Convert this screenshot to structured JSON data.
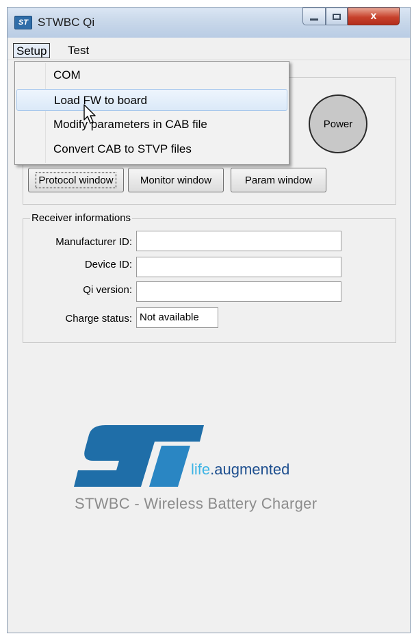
{
  "window": {
    "title": "STWBC Qi",
    "icon": "st-logo-icon",
    "close_glyph": "x"
  },
  "menubar": {
    "setup": "Setup",
    "test": "Test"
  },
  "setup_menu": {
    "items": [
      "COM",
      "Load FW to board",
      "Modify parameters in CAB file",
      "Convert CAB to STVP files"
    ],
    "highlighted": "Load FW to board"
  },
  "controls": {
    "power": "Power",
    "protocol_window": "Protocol window",
    "monitor_window": "Monitor window",
    "param_window": "Param window"
  },
  "receiver": {
    "title": "Receiver informations",
    "manufacturer_id_label": "Manufacturer ID:",
    "manufacturer_id_value": "",
    "device_id_label": "Device ID:",
    "device_id_value": "",
    "qi_version_label": "Qi version:",
    "qi_version_value": "",
    "charge_status_label": "Charge status:",
    "charge_status_value": "Not available"
  },
  "branding": {
    "logo": "st-logo",
    "tagline_life": "life",
    "tagline_rest": ".augmented",
    "product": "STWBC - Wireless Battery Charger"
  },
  "colors": {
    "logo_blue": "#1f6ea8",
    "tagline_blue": "#1e4f8f",
    "tagline_light": "#3db4e5",
    "close_red": "#c7412c"
  }
}
